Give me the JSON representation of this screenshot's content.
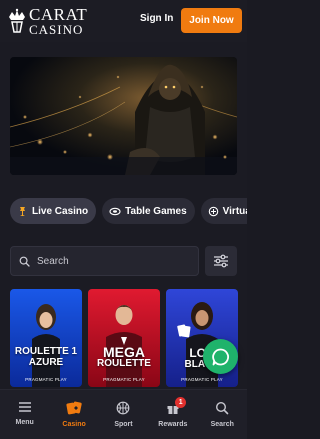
{
  "header": {
    "logo_line1": "CARAT",
    "logo_line2": "CASINO",
    "signin_label": "Sign In",
    "join_label": "Join Now",
    "accent_color": "#f07b10"
  },
  "chips": [
    {
      "label": "Live Casino",
      "icon": "live-casino-icon"
    },
    {
      "label": "Table Games",
      "icon": "table-games-icon"
    },
    {
      "label": "Virtual G",
      "icon": "virtual-games-icon"
    }
  ],
  "search": {
    "placeholder": "Search"
  },
  "games": [
    {
      "title_line1": "ROULETTE 1",
      "title_line2": "AZURE",
      "provider": "PRAGMATIC PLAY",
      "color": "#1e4fd8"
    },
    {
      "title_line1": "MEGA",
      "title_line2": "ROULETTE",
      "provider": "PRAGMATIC PLAY",
      "color": "#d4172b"
    },
    {
      "title_line1": "LOB",
      "title_line2": "BLACK",
      "provider": "PRAGMATIC PLAY",
      "color": "#2b3fd0"
    }
  ],
  "bottom_nav": [
    {
      "label": "Menu",
      "icon": "menu-icon"
    },
    {
      "label": "Casino",
      "icon": "casino-icon",
      "active": true
    },
    {
      "label": "Sport",
      "icon": "basketball-icon"
    },
    {
      "label": "Rewards",
      "icon": "gift-icon",
      "badge": "1"
    },
    {
      "label": "Search",
      "icon": "search-icon"
    }
  ]
}
